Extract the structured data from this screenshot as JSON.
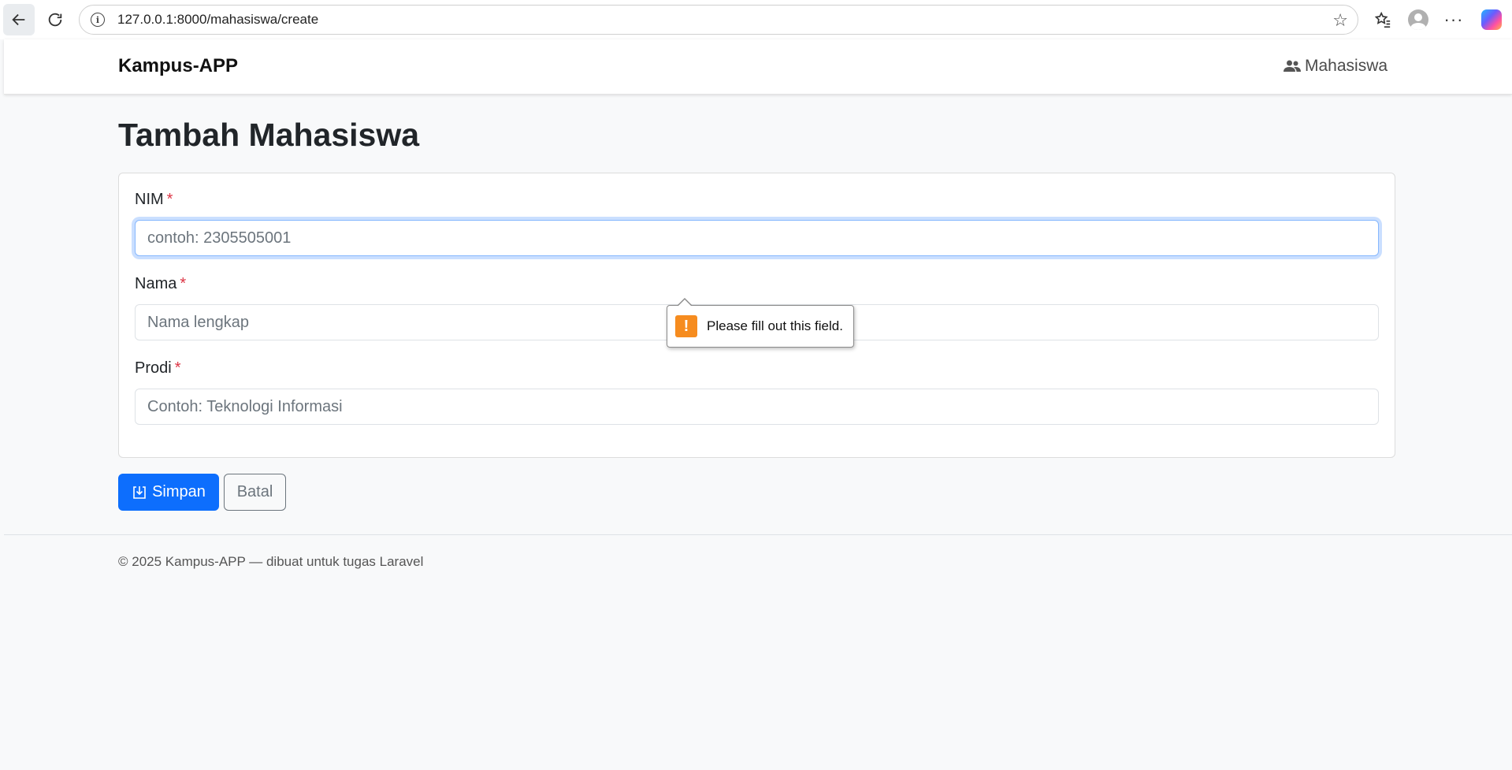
{
  "browser": {
    "url": "127.0.0.1:8000/mahasiswa/create"
  },
  "navbar": {
    "brand": "Kampus-APP",
    "link_label": "Mahasiswa"
  },
  "page": {
    "title": "Tambah Mahasiswa"
  },
  "form": {
    "nim": {
      "label": "NIM",
      "required_mark": "*",
      "value": "",
      "placeholder": "contoh: 2305505001"
    },
    "nama": {
      "label": "Nama",
      "required_mark": "*",
      "value": "",
      "placeholder": "Nama lengkap"
    },
    "prodi": {
      "label": "Prodi",
      "required_mark": "*",
      "value": "",
      "placeholder": "Contoh: Teknologi Informasi"
    },
    "validation_message": "Please fill out this field.",
    "save_label": "Simpan",
    "cancel_label": "Batal"
  },
  "footer": {
    "text": "© 2025 Kampus-APP — dibuat untuk tugas Laravel"
  },
  "colors": {
    "primary": "#0d6efd",
    "required": "#dc3545",
    "warning": "#f68c1f",
    "focus_ring": "#86b7fe"
  },
  "icons": {
    "back": "arrow-left-icon",
    "reload": "reload-icon",
    "info": "info-icon",
    "star": "star-icon",
    "favorites": "favorites-icon",
    "profile": "profile-icon",
    "more": "more-icon",
    "copilot": "copilot-icon",
    "users": "users-icon",
    "save": "download-icon",
    "warning": "warning-icon"
  }
}
